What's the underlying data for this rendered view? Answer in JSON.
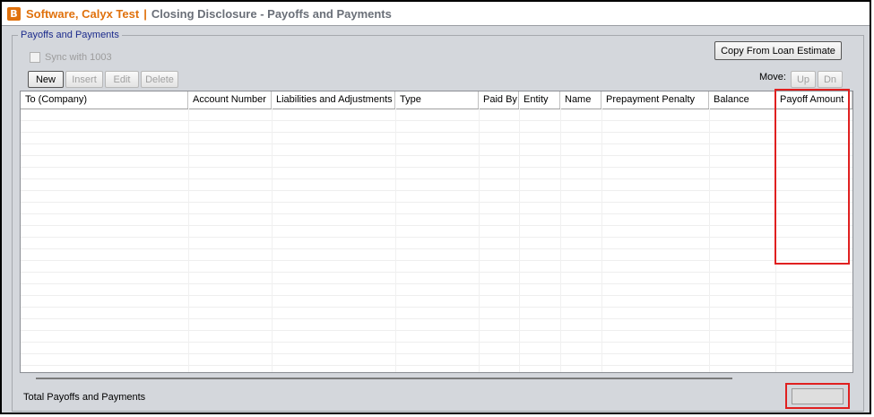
{
  "title": {
    "logo_letter": "B",
    "borrower": "Software, Calyx Test",
    "separator": "|",
    "page": "Closing Disclosure - Payoffs and Payments"
  },
  "group": {
    "label": "Payoffs and Payments"
  },
  "sync": {
    "label": "Sync with 1003",
    "checked": false,
    "enabled": false
  },
  "toolbar": {
    "new_label": "New",
    "insert_label": "Insert",
    "edit_label": "Edit",
    "delete_label": "Delete",
    "copy_label": "Copy From Loan Estimate",
    "move_label": "Move:",
    "up_label": "Up",
    "down_label": "Dn"
  },
  "grid": {
    "columns": [
      "To (Company)",
      "Account Number",
      "Liabilities and Adjustments",
      "Type",
      "Paid By",
      "Entity",
      "Name",
      "Prepayment Penalty",
      "Balance",
      "Payoff Amount"
    ],
    "rows": []
  },
  "footer": {
    "total_label": "Total Payoffs and Payments",
    "total_value": ""
  },
  "colors": {
    "brand": "#e0710c",
    "legend": "#1c2b8c",
    "highlight": "#e02020"
  }
}
